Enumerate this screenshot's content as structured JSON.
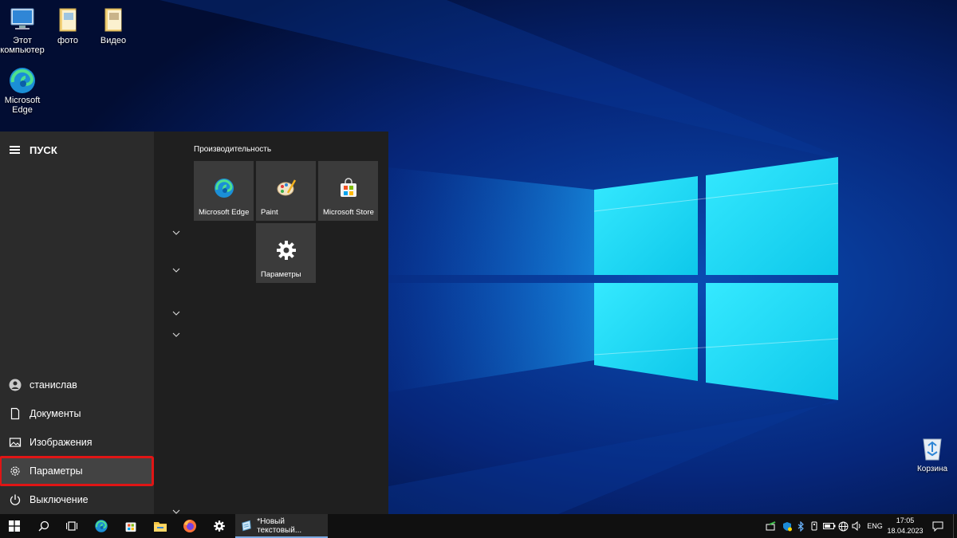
{
  "desktop": {
    "icons": [
      {
        "label_line1": "Этот",
        "label_line2": "компьютер",
        "icon": "computer-icon"
      },
      {
        "label_line1": "фото",
        "label_line2": "",
        "icon": "folder-icon"
      },
      {
        "label_line1": "Видео",
        "label_line2": "",
        "icon": "folder-icon"
      },
      {
        "label_line1": "Microsoft",
        "label_line2": "Edge",
        "icon": "edge-icon"
      }
    ],
    "recycle_bin": {
      "label": "Корзина",
      "icon": "recycle-bin-icon"
    }
  },
  "start_menu": {
    "title": "ПУСК",
    "rail_items": [
      {
        "label": "станислав",
        "icon": "user-icon"
      },
      {
        "label": "Документы",
        "icon": "document-icon"
      },
      {
        "label": "Изображения",
        "icon": "pictures-icon"
      },
      {
        "label": "Параметры",
        "icon": "gear-icon",
        "highlighted": true
      },
      {
        "label": "Выключение",
        "icon": "power-icon"
      }
    ],
    "group_title": "Производительность",
    "tiles": [
      {
        "label": "Microsoft Edge",
        "icon": "edge-icon"
      },
      {
        "label": "Paint",
        "icon": "paint-icon"
      },
      {
        "label": "Microsoft Store",
        "icon": "store-icon"
      },
      {
        "label": "Параметры",
        "icon": "gear-icon"
      }
    ]
  },
  "taskbar": {
    "pinned": [
      "windows-start-icon",
      "search-icon",
      "task-view-icon",
      "edge-icon",
      "store-icon",
      "file-explorer-icon",
      "firefox-icon",
      "gear-icon"
    ],
    "active_window": {
      "label": "*Новый текстовый...",
      "icon": "notepad-icon"
    },
    "tray": {
      "language": "ENG",
      "time": "17:05",
      "date": "18.04.2023"
    }
  },
  "colors": {
    "accent_highlight": "#e01515",
    "wallpaper_light": "#16e3f8",
    "start_bg": "#2b2b2b"
  }
}
